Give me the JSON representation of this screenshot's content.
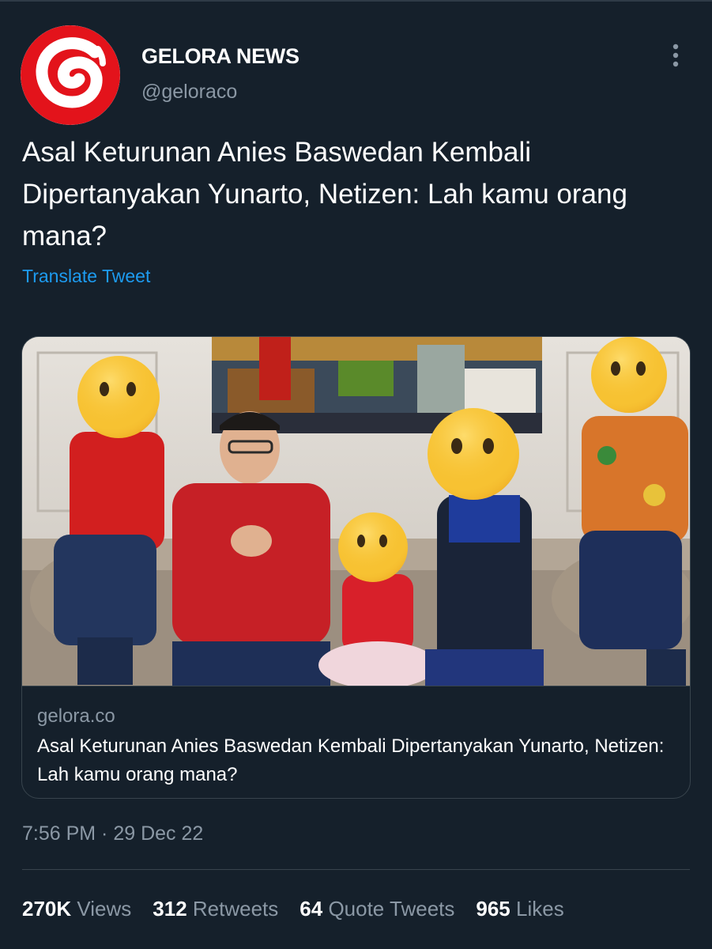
{
  "tweet": {
    "author_name": "GELORA NEWS",
    "author_handle": "@geloraco",
    "text": "Asal Keturunan Anies Baswedan Kembali Dipertanyakan Yunarto, Netizen: Lah kamu orang mana?",
    "translate_label": "Translate Tweet",
    "timestamp": "7:56 PM · 29 Dec 22"
  },
  "card": {
    "domain": "gelora.co",
    "title": "Asal Keturunan Anies Baswedan Kembali Dipertanyakan Yunarto, Netizen: Lah kamu orang mana?"
  },
  "stats": [
    {
      "value": "270K",
      "label": "Views"
    },
    {
      "value": "312",
      "label": "Retweets"
    },
    {
      "value": "64",
      "label": "Quote Tweets"
    },
    {
      "value": "965",
      "label": "Likes"
    }
  ],
  "icons": {
    "avatar": "gelora-logo-icon",
    "more": "more-vertical-icon"
  },
  "colors": {
    "background": "#15202b",
    "link": "#1d9bf0",
    "secondary_text": "#8b98a5",
    "brand_red": "#e3131b"
  }
}
